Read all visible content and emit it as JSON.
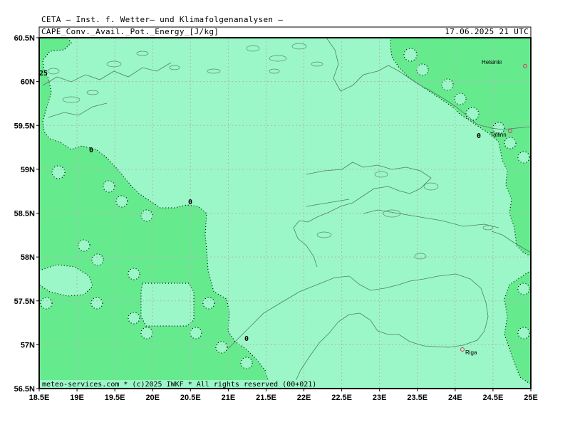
{
  "header": {
    "title": "CETA — Inst. f. Wetter— und Klimafolgenanalysen —",
    "field": "CAPE_Conv._Avail._Pot._Energy_[J/kg]",
    "valid_time": "17.06.2025 21 UTC"
  },
  "footer": {
    "copyright": "meteo-services.com * (c)2025 IWKF * All rights reserved (00+021)"
  },
  "axes": {
    "lat_labels": [
      "60.5N",
      "60N",
      "59.5N",
      "59N",
      "58.5N",
      "58N",
      "57.5N",
      "57N",
      "56.5N"
    ],
    "lon_labels": [
      "18.5E",
      "19E",
      "19.5E",
      "20E",
      "20.5E",
      "21E",
      "21.5E",
      "22E",
      "22.5E",
      "23E",
      "23.5E",
      "24E",
      "24.5E",
      "25E"
    ]
  },
  "cities": [
    {
      "name": "Helsinki"
    },
    {
      "name": "Tallinn"
    },
    {
      "name": "Riga"
    }
  ],
  "contour_labels": [
    "0",
    "0",
    "0",
    "0"
  ],
  "edge_value": "25",
  "colors": {
    "cape_zero": "#9bf7c8",
    "cape_low": "#66ea8e",
    "grid": "#b4b4b4",
    "coast": "#5a8a6a",
    "city_marker": "#e0306a"
  }
}
